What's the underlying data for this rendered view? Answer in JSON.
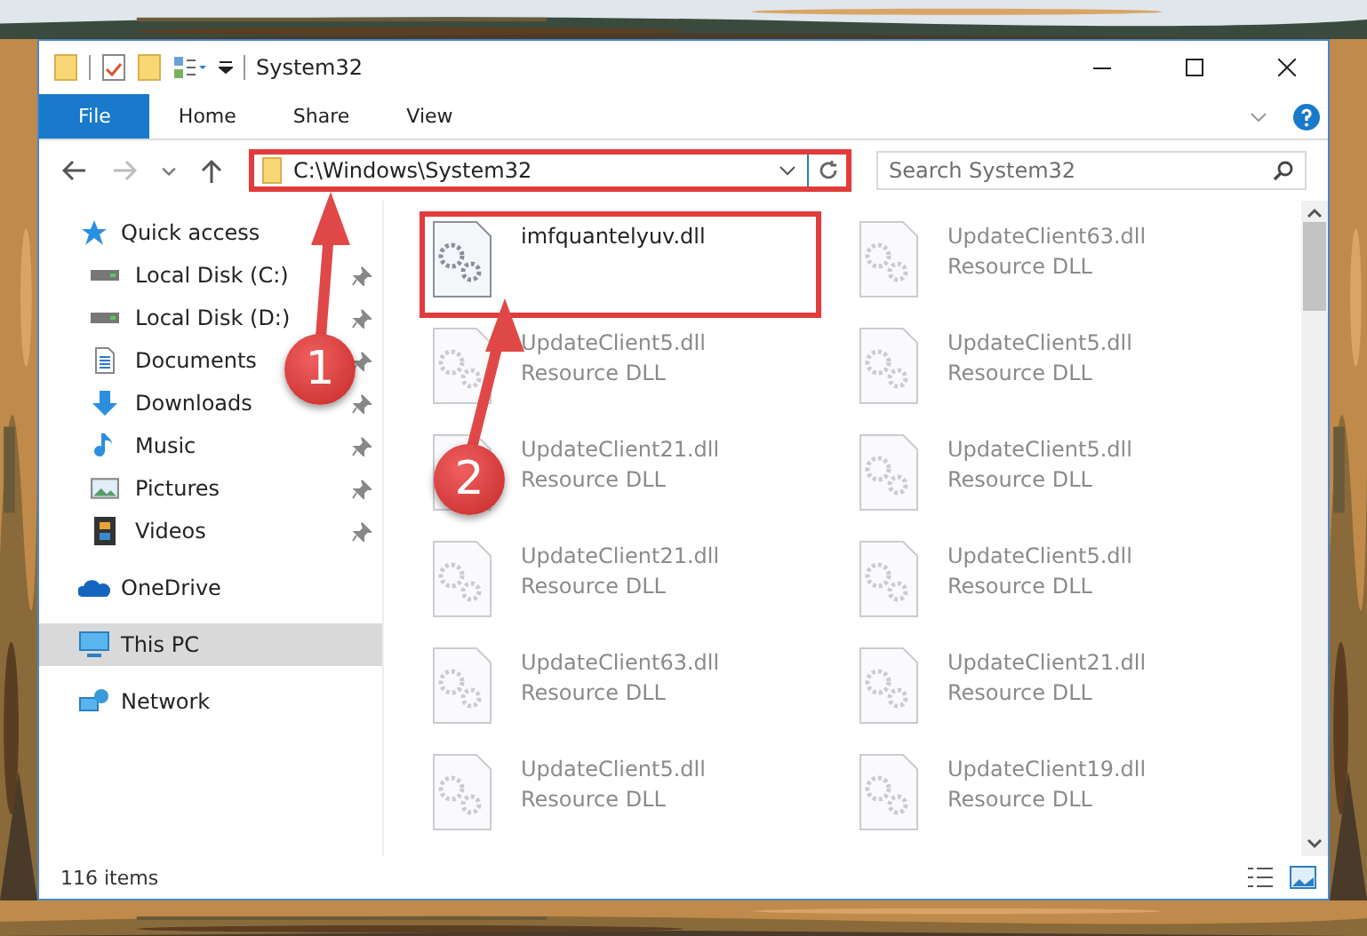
{
  "window": {
    "title": "System32"
  },
  "ribbon_tabs": [
    {
      "label": "File",
      "selected": true
    },
    {
      "label": "Home",
      "selected": false
    },
    {
      "label": "Share",
      "selected": false
    },
    {
      "label": "View",
      "selected": false
    }
  ],
  "address": {
    "value": "C:\\Windows\\System32",
    "highlighted": true
  },
  "search": {
    "placeholder": "Search System32"
  },
  "sidebar": {
    "items": [
      {
        "label": "Quick access",
        "kind": "star",
        "selected": false,
        "children": [
          {
            "label": "Local Disk (C:)",
            "kind": "disk",
            "pinned": true
          },
          {
            "label": "Local Disk (D:)",
            "kind": "disk",
            "pinned": true
          },
          {
            "label": "Documents",
            "kind": "documents",
            "pinned": true
          },
          {
            "label": "Downloads",
            "kind": "downloads",
            "pinned": true
          },
          {
            "label": "Music",
            "kind": "music",
            "pinned": true
          },
          {
            "label": "Pictures",
            "kind": "pictures",
            "pinned": true
          },
          {
            "label": "Videos",
            "kind": "videos",
            "pinned": true
          }
        ]
      },
      {
        "label": "OneDrive",
        "kind": "cloud",
        "selected": false
      },
      {
        "label": "This PC",
        "kind": "pc",
        "selected": true
      },
      {
        "label": "Network",
        "kind": "network",
        "selected": false
      }
    ]
  },
  "files": [
    {
      "name": "imfquantelyuv.dll",
      "blurred": false,
      "highlighted": true
    },
    {
      "name": "UpdateClient63.dll",
      "type": "Resource DLL",
      "blurred": true,
      "highlighted": false
    },
    {
      "name": "UpdateClient5.dll",
      "type": "Resource DLL",
      "blurred": true,
      "highlighted": false
    },
    {
      "name": "UpdateClient5.dll",
      "type": "Resource DLL",
      "blurred": true,
      "highlighted": false
    },
    {
      "name": "UpdateClient21.dll",
      "type": "Resource DLL",
      "blurred": true,
      "highlighted": false
    },
    {
      "name": "UpdateClient5.dll",
      "type": "Resource DLL",
      "blurred": true,
      "highlighted": false
    },
    {
      "name": "UpdateClient21.dll",
      "type": "Resource DLL",
      "blurred": true,
      "highlighted": false
    },
    {
      "name": "UpdateClient5.dll",
      "type": "Resource DLL",
      "blurred": true,
      "highlighted": false
    },
    {
      "name": "UpdateClient63.dll",
      "type": "Resource DLL",
      "blurred": true,
      "highlighted": false
    },
    {
      "name": "UpdateClient21.dll",
      "type": "Resource DLL",
      "blurred": true,
      "highlighted": false
    },
    {
      "name": "UpdateClient5.dll",
      "type": "Resource DLL",
      "blurred": true,
      "highlighted": false
    },
    {
      "name": "UpdateClient19.dll",
      "type": "Resource DLL",
      "blurred": true,
      "highlighted": false
    }
  ],
  "status_bar": {
    "count": "116 items"
  },
  "annotations": [
    {
      "label": "1"
    },
    {
      "label": "2"
    }
  ]
}
